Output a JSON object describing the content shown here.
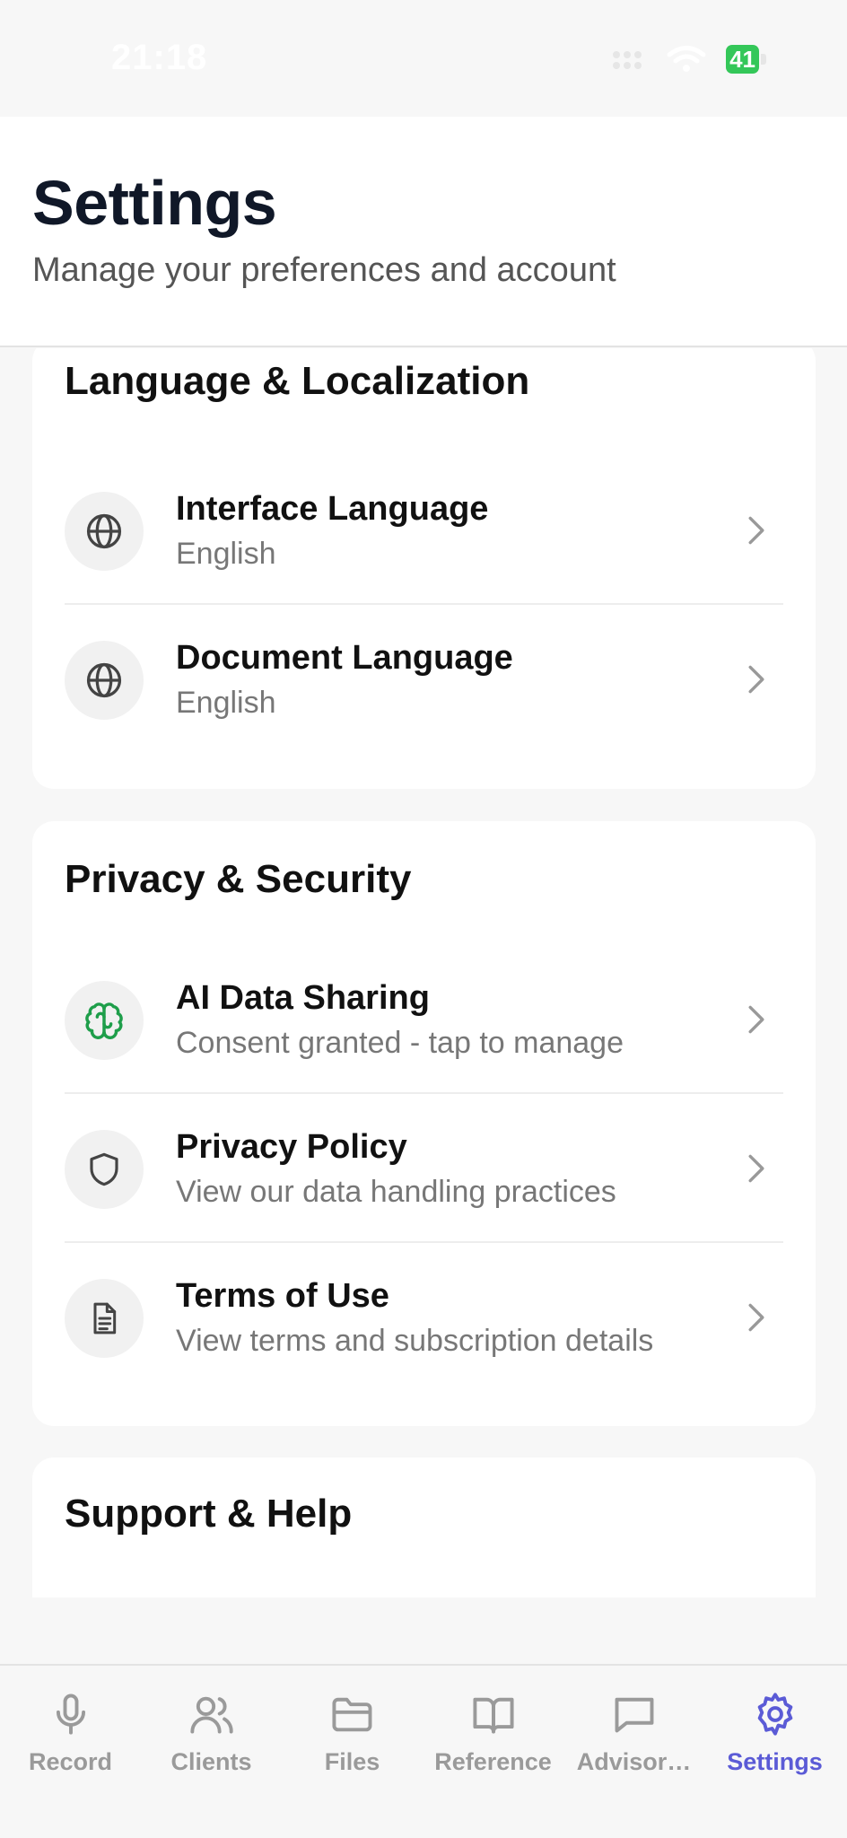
{
  "status_bar": {
    "time": "21:18",
    "battery": "41"
  },
  "header": {
    "title": "Settings",
    "subtitle": "Manage your preferences and account"
  },
  "sections": {
    "language": {
      "title": "Language & Localization",
      "items": [
        {
          "title": "Interface Language",
          "value": "English",
          "icon": "globe-icon"
        },
        {
          "title": "Document Language",
          "value": "English",
          "icon": "globe-icon"
        }
      ]
    },
    "privacy": {
      "title": "Privacy & Security",
      "items": [
        {
          "title": "AI Data Sharing",
          "value": "Consent granted - tap to manage",
          "icon": "brain-icon"
        },
        {
          "title": "Privacy Policy",
          "value": "View our data handling practices",
          "icon": "shield-icon"
        },
        {
          "title": "Terms of Use",
          "value": "View terms and subscription details",
          "icon": "document-icon"
        }
      ]
    },
    "support": {
      "title": "Support & Help"
    }
  },
  "tabbar": {
    "tabs": [
      {
        "label": "Record",
        "icon": "microphone-icon"
      },
      {
        "label": "Clients",
        "icon": "users-icon"
      },
      {
        "label": "Files",
        "icon": "folder-icon"
      },
      {
        "label": "Reference",
        "icon": "book-icon"
      },
      {
        "label": "Advisor…",
        "icon": "chat-icon"
      },
      {
        "label": "Settings",
        "icon": "gear-icon"
      }
    ],
    "active": "Settings"
  },
  "colors": {
    "accent": "#5b5bd6",
    "brain_icon": "#1e9e4a",
    "battery": "#34c759"
  }
}
